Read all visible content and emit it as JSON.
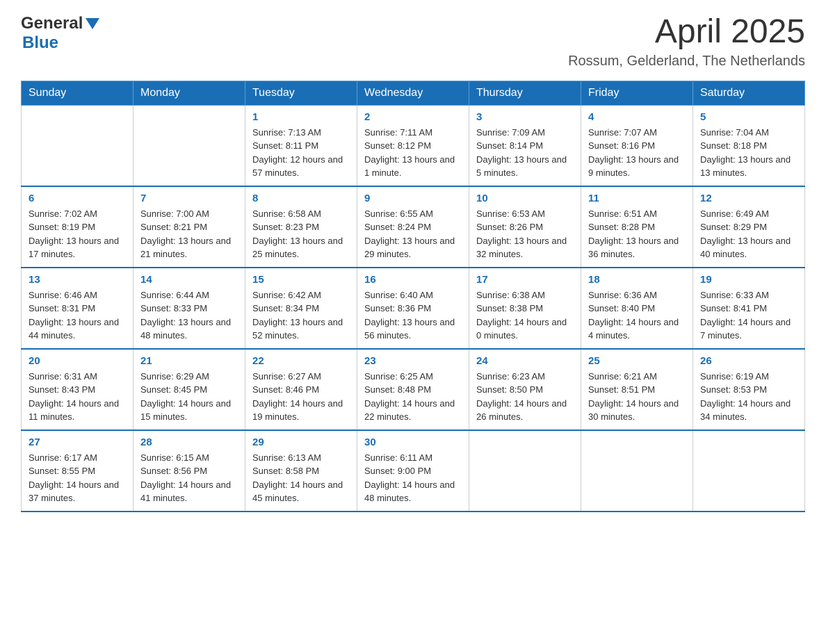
{
  "header": {
    "logo": {
      "general": "General",
      "blue": "Blue",
      "arrow_symbol": "▼"
    },
    "title": "April 2025",
    "location": "Rossum, Gelderland, The Netherlands"
  },
  "calendar": {
    "weekdays": [
      "Sunday",
      "Monday",
      "Tuesday",
      "Wednesday",
      "Thursday",
      "Friday",
      "Saturday"
    ],
    "weeks": [
      [
        {
          "day": "",
          "sunrise": "",
          "sunset": "",
          "daylight": ""
        },
        {
          "day": "",
          "sunrise": "",
          "sunset": "",
          "daylight": ""
        },
        {
          "day": "1",
          "sunrise": "Sunrise: 7:13 AM",
          "sunset": "Sunset: 8:11 PM",
          "daylight": "Daylight: 12 hours and 57 minutes."
        },
        {
          "day": "2",
          "sunrise": "Sunrise: 7:11 AM",
          "sunset": "Sunset: 8:12 PM",
          "daylight": "Daylight: 13 hours and 1 minute."
        },
        {
          "day": "3",
          "sunrise": "Sunrise: 7:09 AM",
          "sunset": "Sunset: 8:14 PM",
          "daylight": "Daylight: 13 hours and 5 minutes."
        },
        {
          "day": "4",
          "sunrise": "Sunrise: 7:07 AM",
          "sunset": "Sunset: 8:16 PM",
          "daylight": "Daylight: 13 hours and 9 minutes."
        },
        {
          "day": "5",
          "sunrise": "Sunrise: 7:04 AM",
          "sunset": "Sunset: 8:18 PM",
          "daylight": "Daylight: 13 hours and 13 minutes."
        }
      ],
      [
        {
          "day": "6",
          "sunrise": "Sunrise: 7:02 AM",
          "sunset": "Sunset: 8:19 PM",
          "daylight": "Daylight: 13 hours and 17 minutes."
        },
        {
          "day": "7",
          "sunrise": "Sunrise: 7:00 AM",
          "sunset": "Sunset: 8:21 PM",
          "daylight": "Daylight: 13 hours and 21 minutes."
        },
        {
          "day": "8",
          "sunrise": "Sunrise: 6:58 AM",
          "sunset": "Sunset: 8:23 PM",
          "daylight": "Daylight: 13 hours and 25 minutes."
        },
        {
          "day": "9",
          "sunrise": "Sunrise: 6:55 AM",
          "sunset": "Sunset: 8:24 PM",
          "daylight": "Daylight: 13 hours and 29 minutes."
        },
        {
          "day": "10",
          "sunrise": "Sunrise: 6:53 AM",
          "sunset": "Sunset: 8:26 PM",
          "daylight": "Daylight: 13 hours and 32 minutes."
        },
        {
          "day": "11",
          "sunrise": "Sunrise: 6:51 AM",
          "sunset": "Sunset: 8:28 PM",
          "daylight": "Daylight: 13 hours and 36 minutes."
        },
        {
          "day": "12",
          "sunrise": "Sunrise: 6:49 AM",
          "sunset": "Sunset: 8:29 PM",
          "daylight": "Daylight: 13 hours and 40 minutes."
        }
      ],
      [
        {
          "day": "13",
          "sunrise": "Sunrise: 6:46 AM",
          "sunset": "Sunset: 8:31 PM",
          "daylight": "Daylight: 13 hours and 44 minutes."
        },
        {
          "day": "14",
          "sunrise": "Sunrise: 6:44 AM",
          "sunset": "Sunset: 8:33 PM",
          "daylight": "Daylight: 13 hours and 48 minutes."
        },
        {
          "day": "15",
          "sunrise": "Sunrise: 6:42 AM",
          "sunset": "Sunset: 8:34 PM",
          "daylight": "Daylight: 13 hours and 52 minutes."
        },
        {
          "day": "16",
          "sunrise": "Sunrise: 6:40 AM",
          "sunset": "Sunset: 8:36 PM",
          "daylight": "Daylight: 13 hours and 56 minutes."
        },
        {
          "day": "17",
          "sunrise": "Sunrise: 6:38 AM",
          "sunset": "Sunset: 8:38 PM",
          "daylight": "Daylight: 14 hours and 0 minutes."
        },
        {
          "day": "18",
          "sunrise": "Sunrise: 6:36 AM",
          "sunset": "Sunset: 8:40 PM",
          "daylight": "Daylight: 14 hours and 4 minutes."
        },
        {
          "day": "19",
          "sunrise": "Sunrise: 6:33 AM",
          "sunset": "Sunset: 8:41 PM",
          "daylight": "Daylight: 14 hours and 7 minutes."
        }
      ],
      [
        {
          "day": "20",
          "sunrise": "Sunrise: 6:31 AM",
          "sunset": "Sunset: 8:43 PM",
          "daylight": "Daylight: 14 hours and 11 minutes."
        },
        {
          "day": "21",
          "sunrise": "Sunrise: 6:29 AM",
          "sunset": "Sunset: 8:45 PM",
          "daylight": "Daylight: 14 hours and 15 minutes."
        },
        {
          "day": "22",
          "sunrise": "Sunrise: 6:27 AM",
          "sunset": "Sunset: 8:46 PM",
          "daylight": "Daylight: 14 hours and 19 minutes."
        },
        {
          "day": "23",
          "sunrise": "Sunrise: 6:25 AM",
          "sunset": "Sunset: 8:48 PM",
          "daylight": "Daylight: 14 hours and 22 minutes."
        },
        {
          "day": "24",
          "sunrise": "Sunrise: 6:23 AM",
          "sunset": "Sunset: 8:50 PM",
          "daylight": "Daylight: 14 hours and 26 minutes."
        },
        {
          "day": "25",
          "sunrise": "Sunrise: 6:21 AM",
          "sunset": "Sunset: 8:51 PM",
          "daylight": "Daylight: 14 hours and 30 minutes."
        },
        {
          "day": "26",
          "sunrise": "Sunrise: 6:19 AM",
          "sunset": "Sunset: 8:53 PM",
          "daylight": "Daylight: 14 hours and 34 minutes."
        }
      ],
      [
        {
          "day": "27",
          "sunrise": "Sunrise: 6:17 AM",
          "sunset": "Sunset: 8:55 PM",
          "daylight": "Daylight: 14 hours and 37 minutes."
        },
        {
          "day": "28",
          "sunrise": "Sunrise: 6:15 AM",
          "sunset": "Sunset: 8:56 PM",
          "daylight": "Daylight: 14 hours and 41 minutes."
        },
        {
          "day": "29",
          "sunrise": "Sunrise: 6:13 AM",
          "sunset": "Sunset: 8:58 PM",
          "daylight": "Daylight: 14 hours and 45 minutes."
        },
        {
          "day": "30",
          "sunrise": "Sunrise: 6:11 AM",
          "sunset": "Sunset: 9:00 PM",
          "daylight": "Daylight: 14 hours and 48 minutes."
        },
        {
          "day": "",
          "sunrise": "",
          "sunset": "",
          "daylight": ""
        },
        {
          "day": "",
          "sunrise": "",
          "sunset": "",
          "daylight": ""
        },
        {
          "day": "",
          "sunrise": "",
          "sunset": "",
          "daylight": ""
        }
      ]
    ]
  }
}
